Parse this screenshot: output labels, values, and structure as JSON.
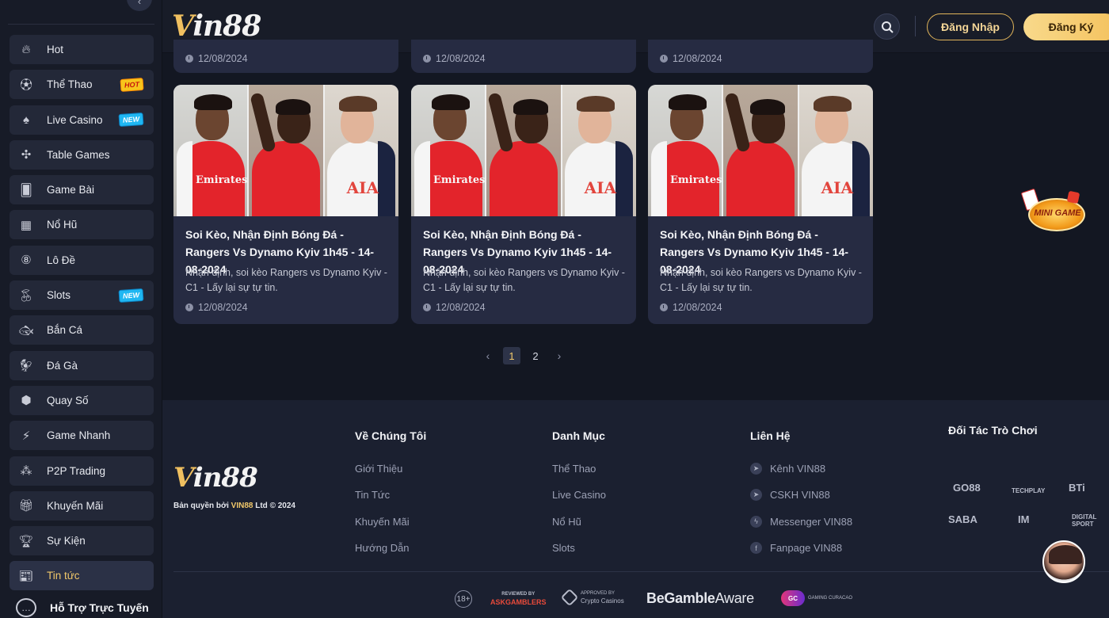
{
  "sidebar": {
    "items": [
      {
        "label": "Hot",
        "icon": "flame-icon",
        "badge": ""
      },
      {
        "label": "Thể Thao",
        "icon": "soccer-ball-icon",
        "badge": "HOT"
      },
      {
        "label": "Live Casino",
        "icon": "spade-icon",
        "badge": "NEW"
      },
      {
        "label": "Table Games",
        "icon": "table-game-icon",
        "badge": ""
      },
      {
        "label": "Game Bài",
        "icon": "cards-icon",
        "badge": ""
      },
      {
        "label": "Nổ Hũ",
        "icon": "slot-machine-icon",
        "badge": ""
      },
      {
        "label": "Lô Đề",
        "icon": "lottery-ball-icon",
        "badge": ""
      },
      {
        "label": "Slots",
        "icon": "cherry-icon",
        "badge": "NEW"
      },
      {
        "label": "Bắn Cá",
        "icon": "fish-icon",
        "badge": ""
      },
      {
        "label": "Đá Gà",
        "icon": "rooster-icon",
        "badge": ""
      },
      {
        "label": "Quay Số",
        "icon": "wheel-icon",
        "badge": ""
      },
      {
        "label": "Game Nhanh",
        "icon": "lightning-icon",
        "badge": ""
      },
      {
        "label": "P2P Trading",
        "icon": "p2p-icon",
        "badge": ""
      },
      {
        "label": "Khuyến Mãi",
        "icon": "gift-icon",
        "badge": ""
      },
      {
        "label": "Sự Kiện",
        "icon": "trophy-icon",
        "badge": ""
      },
      {
        "label": "Tin tức",
        "icon": "news-icon",
        "badge": ""
      }
    ],
    "support_label": "Hỗ Trợ Trực Tuyến"
  },
  "header": {
    "logo_v": "V",
    "logo_rest": "in88",
    "login_label": "Đăng Nhập",
    "register_label": "Đăng Ký"
  },
  "top_cards": [
    {
      "date": "12/08/2024"
    },
    {
      "date": "12/08/2024"
    },
    {
      "date": "12/08/2024"
    }
  ],
  "cards": [
    {
      "title": "Soi Kèo, Nhận Định Bóng Đá - Rangers Vs Dynamo Kyiv 1h45 - 14-08-2024",
      "desc": "Nhận định, soi kèo Rangers vs Dynamo Kyiv - C1 - Lấy lại sự tự tin.",
      "date": "12/08/2024",
      "sponsor1": "Emirates",
      "sponsor3": "AIA"
    },
    {
      "title": "Soi Kèo, Nhận Định Bóng Đá - Rangers Vs Dynamo Kyiv 1h45 - 14-08-2024",
      "desc": "Nhận định, soi kèo Rangers vs Dynamo Kyiv - C1 - Lấy lại sự tự tin.",
      "date": "12/08/2024",
      "sponsor1": "Emirates",
      "sponsor3": "AIA"
    },
    {
      "title": "Soi Kèo, Nhận Định Bóng Đá - Rangers Vs Dynamo Kyiv 1h45 - 14-08-2024",
      "desc": "Nhận định, soi kèo Rangers vs Dynamo Kyiv - C1 - Lấy lại sự tự tin.",
      "date": "12/08/2024",
      "sponsor1": "Emirates",
      "sponsor3": "AIA"
    }
  ],
  "pagination": {
    "prev": "‹",
    "pages": [
      "1",
      "2"
    ],
    "current": "1",
    "next": "›"
  },
  "mini_game": {
    "label": "MINI GAME"
  },
  "footer": {
    "logo_v": "V",
    "logo_rest": "in88",
    "copyright_prefix": "Bản quyền bởi ",
    "copyright_brand": "VIN88",
    "copyright_suffix": " Ltd © 2024",
    "about": {
      "title": "Về Chúng Tôi",
      "links": [
        "Giới Thiệu",
        "Tin Tức",
        "Khuyến Mãi",
        "Hướng Dẫn"
      ]
    },
    "categories": {
      "title": "Danh Mục",
      "links": [
        "Thể Thao",
        "Live Casino",
        "Nổ Hũ",
        "Slots"
      ]
    },
    "contact": {
      "title": "Liên Hệ",
      "links": [
        {
          "label": "Kênh VIN88",
          "icon": "telegram-icon"
        },
        {
          "label": "CSKH VIN88",
          "icon": "telegram-icon"
        },
        {
          "label": "Messenger VIN88",
          "icon": "messenger-icon"
        },
        {
          "label": "Fanpage VIN88",
          "icon": "facebook-icon"
        }
      ]
    },
    "partners": {
      "title": "Đối Tác Trò Chơi",
      "names": [
        "GO88",
        "TECHPLAY",
        "BTi",
        "SABA",
        "IM",
        "DIGITAL SPORT"
      ]
    },
    "certs": {
      "age": "18+",
      "ask_top": "REVIEWED BY",
      "ask_main": "ASKGAMBLERS",
      "crypto_top": "APPROVED BY",
      "crypto_main": "Crypto Casinos",
      "gamble_bold": "BeGamble",
      "gamble_light": "Aware",
      "gc_logo": "GC",
      "gc_text": "GAMING CURACAO"
    }
  },
  "colors": {
    "accent": "#f1c86a",
    "background": "#131722",
    "card": "#262b42",
    "sidebar_item": "#232838"
  }
}
